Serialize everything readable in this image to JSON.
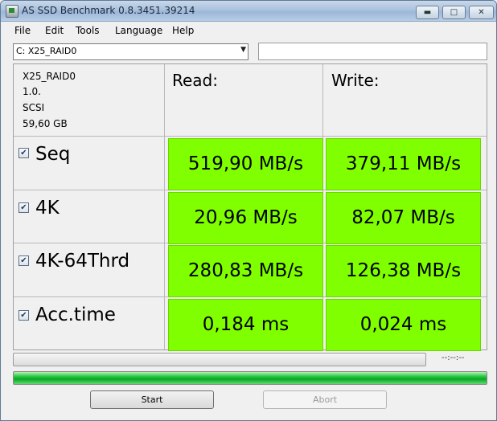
{
  "window": {
    "title": "AS SSD Benchmark 0.8.3451.39214"
  },
  "menu": [
    "File",
    "Edit",
    "Tools",
    "Language",
    "Help"
  ],
  "drive_select": {
    "value": "C: X25_RAID0"
  },
  "name_input": {
    "value": ""
  },
  "drive_info": [
    "X25_RAID0",
    "1.0.",
    "SCSI",
    "59,60 GB"
  ],
  "columns": {
    "read": "Read:",
    "write": "Write:"
  },
  "rows": [
    {
      "name": "Seq",
      "checked": true,
      "read": "519,90 MB/s",
      "write": "379,11 MB/s"
    },
    {
      "name": "4K",
      "checked": true,
      "read": "20,96 MB/s",
      "write": "82,07 MB/s"
    },
    {
      "name": "4K-64Thrd",
      "checked": true,
      "read": "280,83 MB/s",
      "write": "126,38 MB/s"
    },
    {
      "name": "Acc.time",
      "checked": true,
      "read": "0,184 ms",
      "write": "0,024 ms"
    }
  ],
  "progress": {
    "time_text": "--:--:--",
    "fraction": 0
  },
  "total_progress": {
    "fraction": 1.0
  },
  "buttons": {
    "start": "Start",
    "abort": "Abort"
  },
  "colors": {
    "result_bg": "#80ff00",
    "titlebar": "#aac2de",
    "progress_green": "#1fc43a"
  }
}
